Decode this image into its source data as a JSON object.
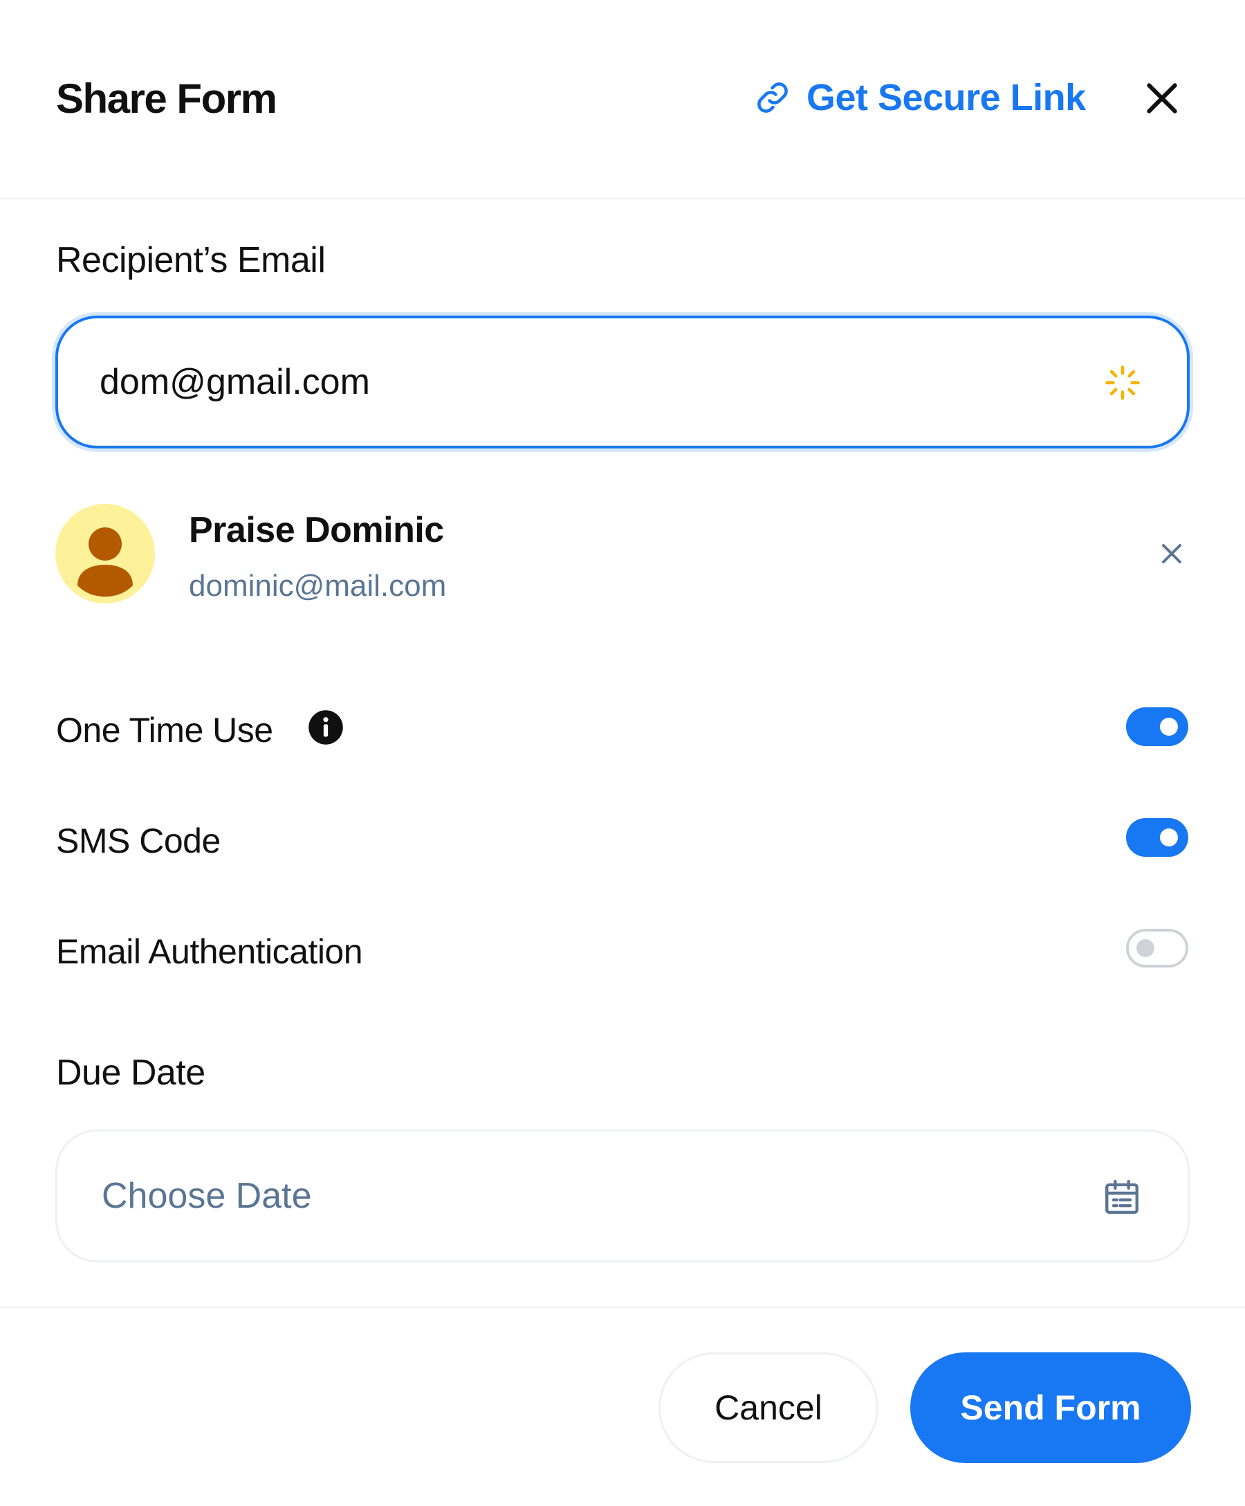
{
  "header": {
    "title": "Share Form",
    "secure_link_label": "Get Secure Link",
    "secure_link_icon": "link-icon",
    "close_icon": "close-icon"
  },
  "recipient_email": {
    "label": "Recipient’s Email",
    "value": "dom@gmail.com",
    "status_icon": "loading-spinner-icon"
  },
  "recipient": {
    "name": "Praise Dominic",
    "email": "dominic@mail.com",
    "avatar_icon": "user-avatar-icon",
    "remove_icon": "close-icon"
  },
  "options": [
    {
      "label": "One Time Use",
      "enabled": true,
      "info_icon": "info-icon"
    },
    {
      "label": "SMS Code",
      "enabled": true
    },
    {
      "label": "Email Authentication",
      "enabled": false
    }
  ],
  "due_date": {
    "label": "Due Date",
    "placeholder": "Choose Date",
    "icon": "calendar-icon"
  },
  "footer": {
    "cancel_label": "Cancel",
    "send_label": "Send Form"
  },
  "colors": {
    "accent": "#1877f2",
    "muted_text": "#5a7594",
    "spinner": "#f5b400",
    "avatar_bg": "#fdf19a",
    "avatar_fg": "#b35a00"
  }
}
